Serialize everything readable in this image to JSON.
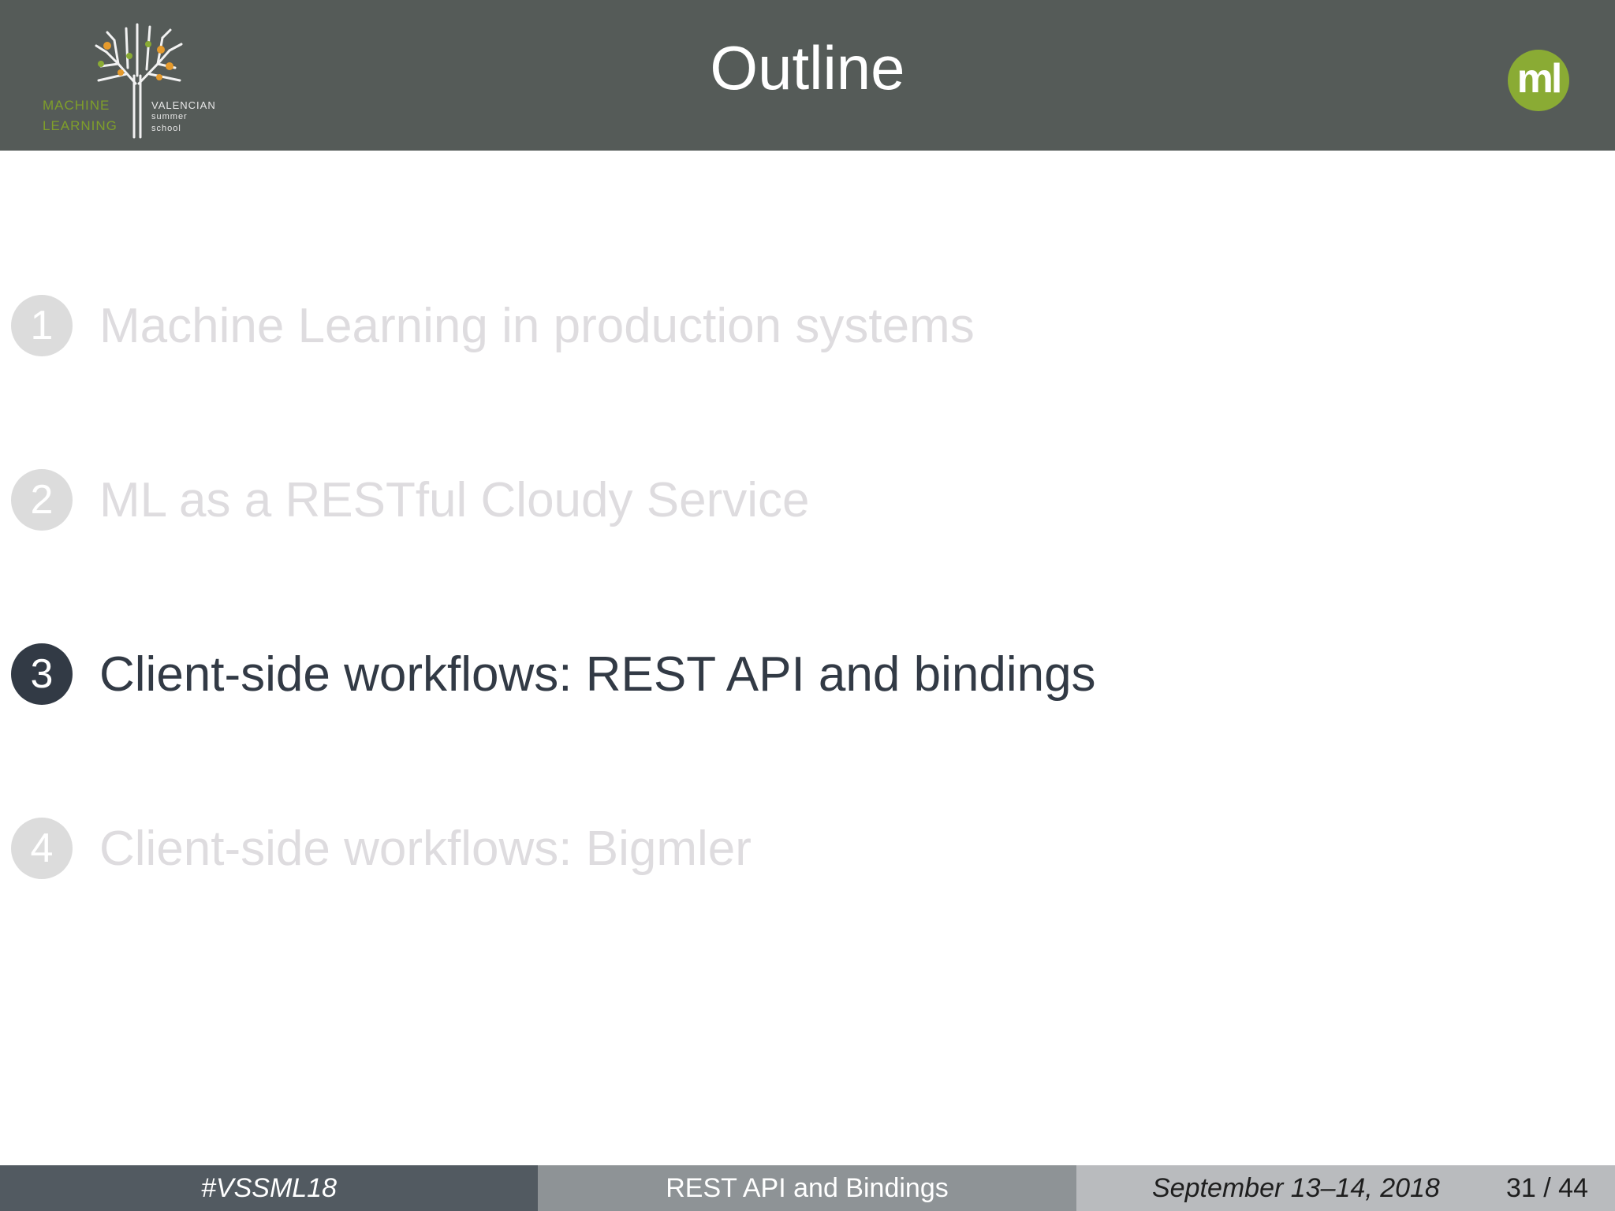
{
  "header": {
    "title": "Outline",
    "logo_left": {
      "name": "machine-learning-valencian-summer-school-logo",
      "line1": "MACHINE",
      "line2": "LEARNING",
      "line3": "VALENCIAN",
      "line4": "summer",
      "line5": "school"
    },
    "logo_right": {
      "name": "bigml-logo",
      "text": "ml",
      "color": "#8aab34"
    },
    "background": "#555b58"
  },
  "outline": {
    "items": [
      {
        "number": "1",
        "label": "Machine Learning in production systems",
        "state": "dimmed"
      },
      {
        "number": "2",
        "label": "ML as a RESTful Cloudy Service",
        "state": "dimmed"
      },
      {
        "number": "3",
        "label": "Client-side workflows: REST API and bindings",
        "state": "active"
      },
      {
        "number": "4",
        "label": "Client-side workflows: Bigmler",
        "state": "dimmed"
      }
    ],
    "active_color": "#323a45",
    "dimmed_color": "#dcdcdc"
  },
  "footer": {
    "hashtag": "#VSSML18",
    "section": "REST API and Bindings",
    "date": "September  13–14, 2018",
    "page": "31 / 44"
  }
}
